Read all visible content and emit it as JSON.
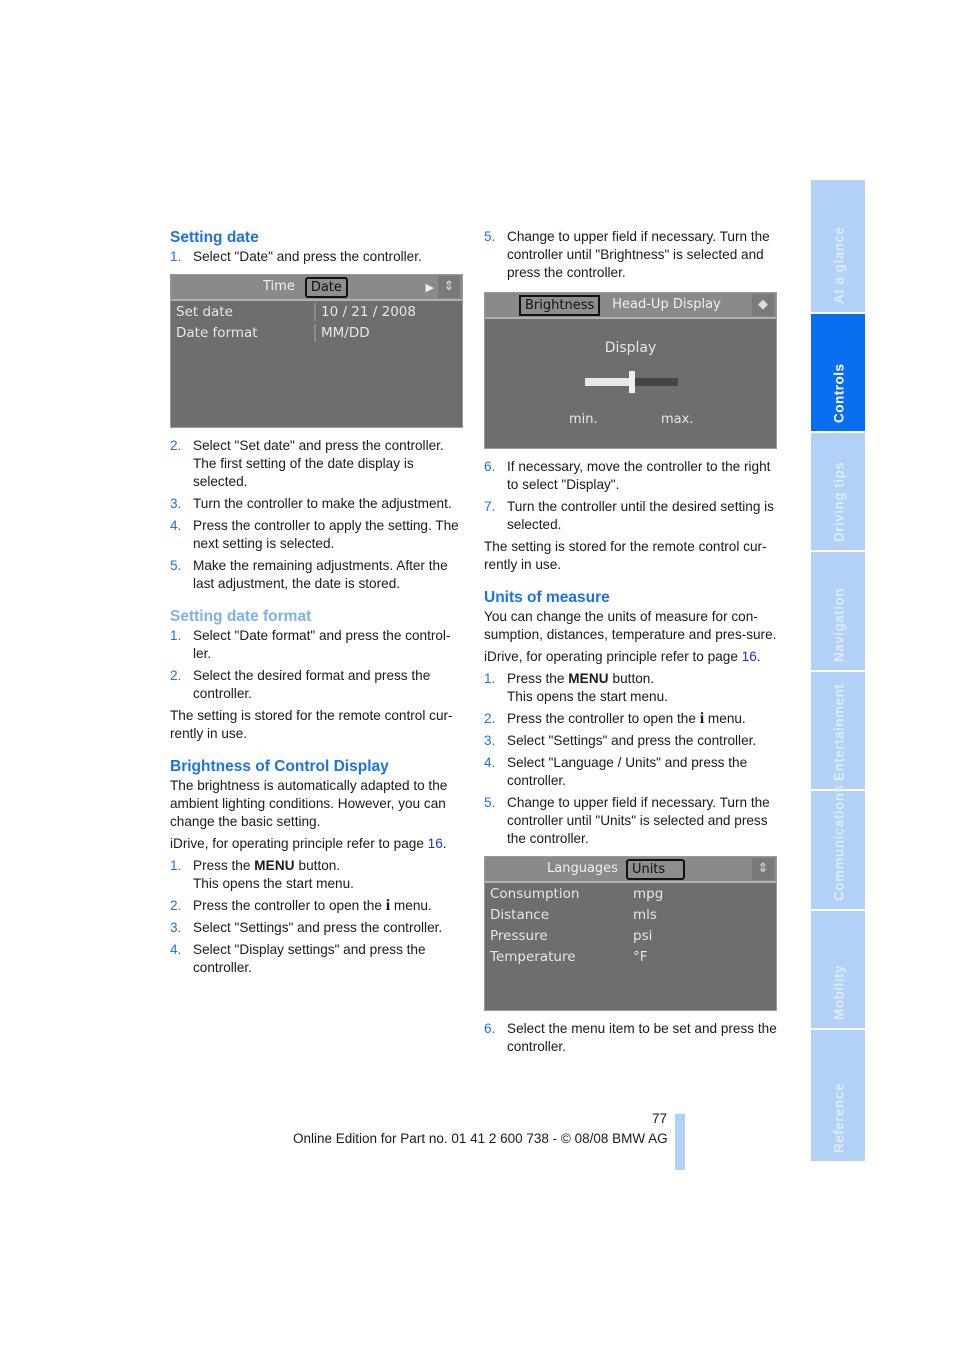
{
  "left": {
    "setting_date": {
      "title": "Setting date",
      "step1": {
        "n": "1.",
        "text": "Select \"Date\" and press the controller."
      },
      "screen": {
        "tabs": [
          "Time",
          "Date"
        ],
        "selected_tab": "Date",
        "rows": [
          {
            "label": "Set date",
            "value": "10 / 21 / 2008"
          },
          {
            "label": "Date format",
            "value": "MM/DD"
          }
        ],
        "icons": [
          "play-arrow-icon",
          "controller-icon"
        ]
      },
      "steps": [
        {
          "n": "2.",
          "text": "Select \"Set date\" and press the controller. The first setting of the date display is selected."
        },
        {
          "n": "3.",
          "text": "Turn the controller to make the adjustment."
        },
        {
          "n": "4.",
          "text": "Press the controller to apply the setting. The next setting is selected."
        },
        {
          "n": "5.",
          "text": "Make the remaining adjustments. After the last adjustment, the date is stored."
        }
      ]
    },
    "setting_date_format": {
      "title": "Setting date format",
      "steps": [
        {
          "n": "1.",
          "text": "Select \"Date format\" and press the control-ler."
        },
        {
          "n": "2.",
          "text": "Select the desired format and press the controller."
        }
      ],
      "note": "The setting is stored for the remote control cur-rently in use."
    },
    "brightness": {
      "title": "Brightness of Control Display",
      "intro": "The brightness is automatically adapted to the ambient lighting conditions. However, you can change the basic setting.",
      "idrive_ref_pre": "iDrive, for operating principle refer to page ",
      "idrive_ref_page": "16",
      "idrive_ref_post": ".",
      "steps": [
        {
          "n": "1.",
          "pre": "Press the ",
          "menu": "MENU",
          "post": " button.",
          "line2": "This opens the start menu."
        },
        {
          "n": "2.",
          "pre": "Press the controller to open the ",
          "icon": "i",
          "post": " menu."
        },
        {
          "n": "3.",
          "text": "Select \"Settings\" and press the controller."
        },
        {
          "n": "4.",
          "text": "Select \"Display settings\" and press the controller."
        }
      ]
    }
  },
  "right": {
    "brightness_cont": {
      "step5": {
        "n": "5.",
        "text": "Change to upper field if necessary. Turn the controller until \"Brightness\" is selected and press the controller."
      },
      "screen": {
        "tabs": [
          "Brightness",
          "Head-Up Display"
        ],
        "selected_tab": "Brightness",
        "label": "Display",
        "min_label": "min.",
        "max_label": "max.",
        "slider_level_percent": 50
      },
      "steps": [
        {
          "n": "6.",
          "text": "If necessary, move the controller to the right to select \"Display\"."
        },
        {
          "n": "7.",
          "text": "Turn the controller until the desired setting is selected."
        }
      ],
      "note": "The setting is stored for the remote control cur-rently in use."
    },
    "units": {
      "title": "Units of measure",
      "intro": "You can change the units of measure for con-sumption, distances, temperature and pres-sure.",
      "idrive_ref_pre": "iDrive, for operating principle refer to page ",
      "idrive_ref_page": "16",
      "idrive_ref_post": ".",
      "steps": [
        {
          "n": "1.",
          "pre": "Press the ",
          "menu": "MENU",
          "post": " button.",
          "line2": "This opens the start menu."
        },
        {
          "n": "2.",
          "pre": "Press the controller to open the ",
          "icon": "i",
          "post": " menu."
        },
        {
          "n": "3.",
          "text": "Select \"Settings\" and press the controller."
        },
        {
          "n": "4.",
          "text": "Select \"Language / Units\" and press the controller."
        },
        {
          "n": "5.",
          "text": "Change to upper field if necessary. Turn the controller until \"Units\" is selected and press the controller."
        }
      ],
      "screen": {
        "tabs": [
          "Languages",
          "Units"
        ],
        "selected_tab": "Units",
        "rows": [
          {
            "label": "Consumption",
            "value": "mpg"
          },
          {
            "label": "Distance",
            "value": "mls"
          },
          {
            "label": "Pressure",
            "value": "psi"
          },
          {
            "label": "Temperature",
            "value": "°F"
          }
        ]
      },
      "step6": {
        "n": "6.",
        "text": "Select the menu item to be set and press the controller."
      }
    }
  },
  "sidebar": {
    "tabs": [
      {
        "label": "At a glance",
        "active": false
      },
      {
        "label": "Controls",
        "active": true
      },
      {
        "label": "Driving tips",
        "active": false
      },
      {
        "label": "Navigation",
        "active": false
      },
      {
        "label": "Entertainment",
        "active": false
      },
      {
        "label": "Communications",
        "active": false
      },
      {
        "label": "Mobility",
        "active": false
      },
      {
        "label": "Reference",
        "active": false
      }
    ],
    "colors": {
      "active": "#0a6ef0",
      "inactive": "#b3d1f6"
    }
  },
  "footer": {
    "page_number": "77",
    "text": "Online Edition for Part no. 01 41 2 600 738 - © 08/08 BMW AG"
  },
  "colors": {
    "heading": "#1b72e8",
    "subheading": "#7fb0ee",
    "link": "#1a33d9"
  }
}
